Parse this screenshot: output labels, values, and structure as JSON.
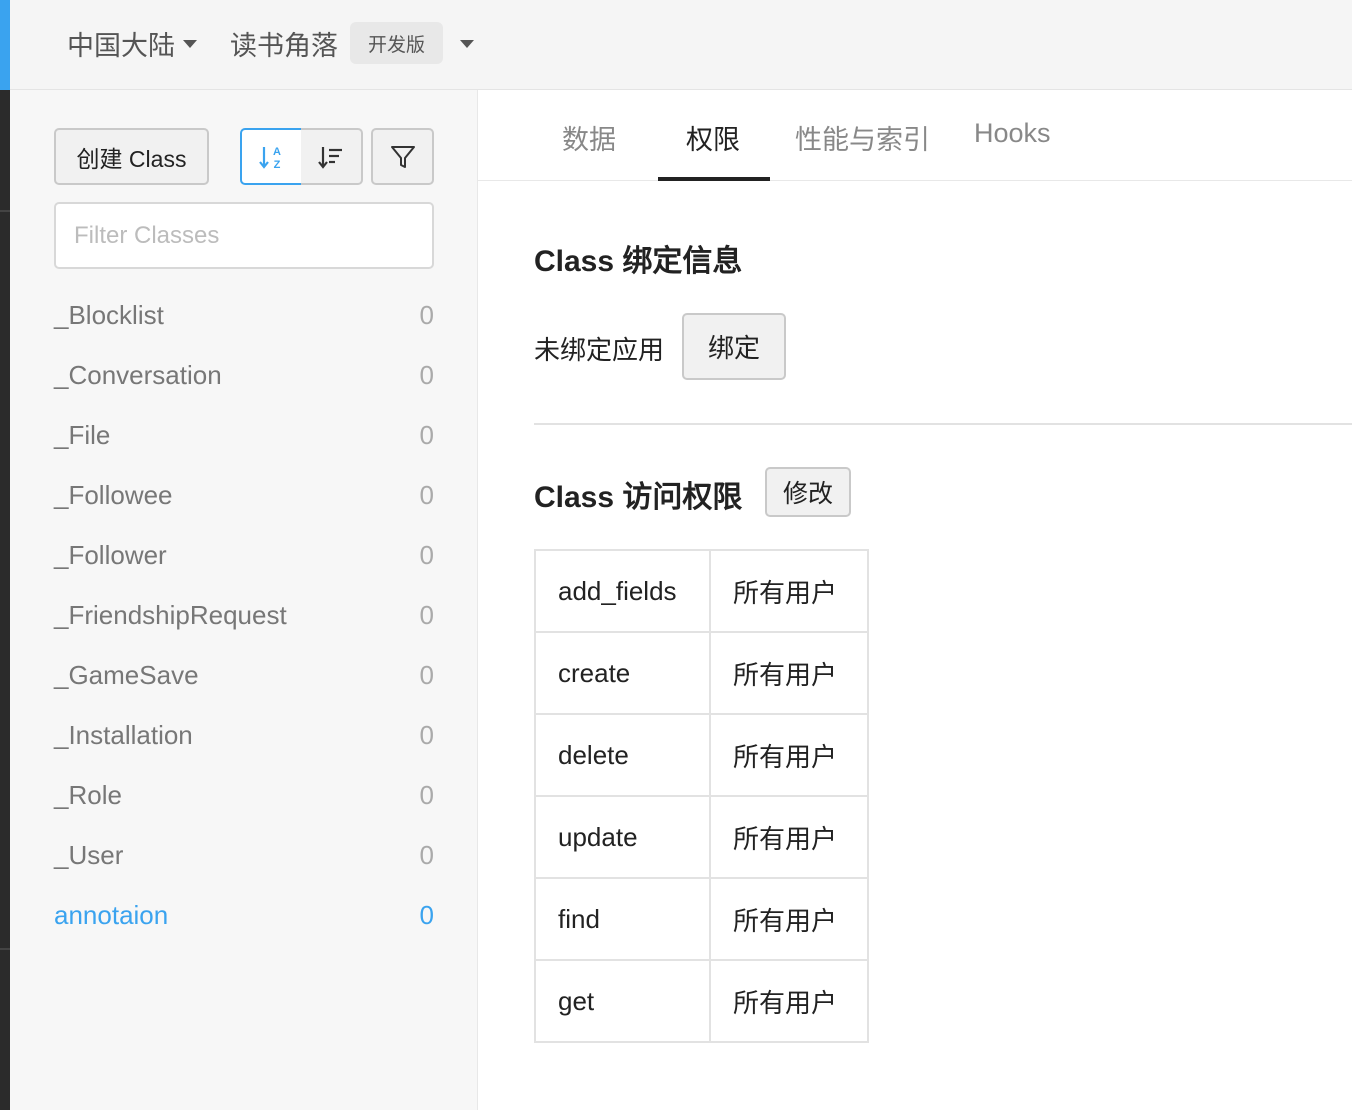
{
  "topbar": {
    "region": "中国大陆",
    "app_name": "读书角落",
    "env_badge": "开发版"
  },
  "sidebar": {
    "create_label": "创建 Class",
    "sort_alpha_icon": "sort-alphabetical-icon",
    "sort_count_icon": "sort-by-count-icon",
    "filter_icon": "filter-funnel-icon",
    "filter_placeholder": "Filter Classes",
    "classes": [
      {
        "name": "_Blocklist",
        "count": "0"
      },
      {
        "name": "_Conversation",
        "count": "0"
      },
      {
        "name": "_File",
        "count": "0"
      },
      {
        "name": "_Followee",
        "count": "0"
      },
      {
        "name": "_Follower",
        "count": "0"
      },
      {
        "name": "_FriendshipRequest",
        "count": "0"
      },
      {
        "name": "_GameSave",
        "count": "0"
      },
      {
        "name": "_Installation",
        "count": "0"
      },
      {
        "name": "_Role",
        "count": "0"
      },
      {
        "name": "_User",
        "count": "0"
      },
      {
        "name": "annotaion",
        "count": "0"
      }
    ],
    "active_class": "annotaion"
  },
  "tabs": [
    {
      "label": "数据"
    },
    {
      "label": "权限"
    },
    {
      "label": "性能与索引"
    },
    {
      "label": "Hooks"
    }
  ],
  "active_tab": "权限",
  "binding": {
    "title": "Class 绑定信息",
    "status": "未绑定应用",
    "bind_label": "绑定"
  },
  "acl": {
    "title": "Class 访问权限",
    "edit_label": "修改",
    "rows": [
      {
        "op": "add_fields",
        "who": "所有用户"
      },
      {
        "op": "create",
        "who": "所有用户"
      },
      {
        "op": "delete",
        "who": "所有用户"
      },
      {
        "op": "update",
        "who": "所有用户"
      },
      {
        "op": "find",
        "who": "所有用户"
      },
      {
        "op": "get",
        "who": "所有用户"
      }
    ]
  },
  "colors": {
    "accent": "#3aa3ef",
    "sidebar_bg": "#f7f7f7",
    "topbar_bg": "#f5f5f5"
  }
}
